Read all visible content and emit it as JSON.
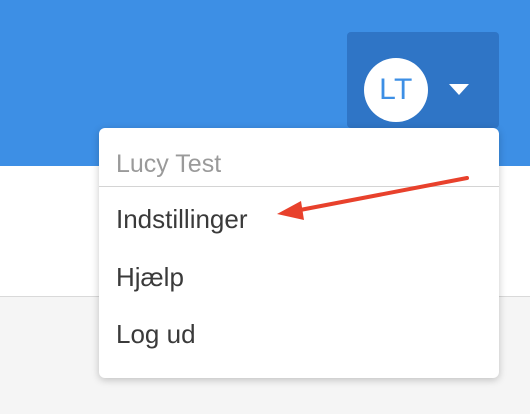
{
  "user_menu": {
    "initials": "LT",
    "caret_icon": "caret-down-icon"
  },
  "dropdown": {
    "user_name": "Lucy Test",
    "items": [
      {
        "label": "Indstillinger"
      },
      {
        "label": "Hjælp"
      },
      {
        "label": "Log ud"
      }
    ]
  },
  "annotation": {
    "arrow_color": "#e8412c",
    "points_to": "Indstillinger"
  },
  "colors": {
    "header": "#3d8fe5",
    "user_button": "#2f75c6"
  }
}
